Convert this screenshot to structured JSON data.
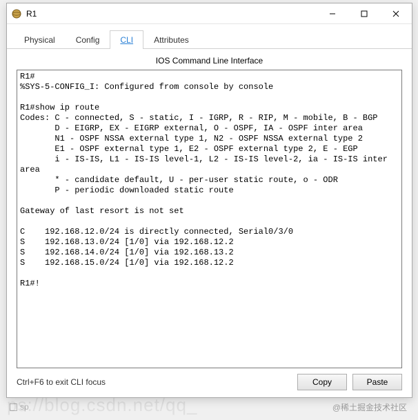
{
  "window": {
    "title": "R1"
  },
  "tabs": {
    "items": [
      {
        "label": "Physical"
      },
      {
        "label": "Config"
      },
      {
        "label": "CLI"
      },
      {
        "label": "Attributes"
      }
    ],
    "active_index": 2
  },
  "panel": {
    "title": "IOS Command Line Interface",
    "terminal_text": "R1#\n%SYS-5-CONFIG_I: Configured from console by console\n\nR1#show ip route\nCodes: C - connected, S - static, I - IGRP, R - RIP, M - mobile, B - BGP\n       D - EIGRP, EX - EIGRP external, O - OSPF, IA - OSPF inter area\n       N1 - OSPF NSSA external type 1, N2 - OSPF NSSA external type 2\n       E1 - OSPF external type 1, E2 - OSPF external type 2, E - EGP\n       i - IS-IS, L1 - IS-IS level-1, L2 - IS-IS level-2, ia - IS-IS inter area\n       * - candidate default, U - per-user static route, o - ODR\n       P - periodic downloaded static route\n\nGateway of last resort is not set\n\nC    192.168.12.0/24 is directly connected, Serial0/3/0\nS    192.168.13.0/24 [1/0] via 192.168.12.2\nS    192.168.14.0/24 [1/0] via 192.168.13.2\nS    192.168.15.0/24 [1/0] via 192.168.12.2\n\nR1#!",
    "hint": "Ctrl+F6 to exit CLI focus",
    "copy_label": "Copy",
    "paste_label": "Paste"
  },
  "footer": {
    "watermark": "@稀土掘金技术社区",
    "bg_watermark": "ps://blog.csdn.net/qq_",
    "corner_label": "sp"
  }
}
